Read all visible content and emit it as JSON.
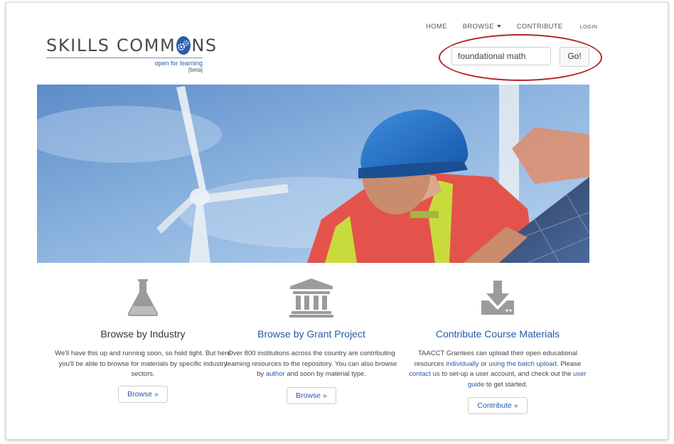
{
  "brand": {
    "name_part1": "SKILLS COMM",
    "name_part2": "NS",
    "tagline": "open for learning",
    "beta": "[beta]"
  },
  "nav": {
    "home": "HOME",
    "browse": "BROWSE",
    "contribute": "CONTRIBUTE",
    "login": "LOGIN"
  },
  "search": {
    "value": "foundational math",
    "button": "Go!"
  },
  "colors": {
    "accent": "#2a58a6",
    "highlight_oval": "#b3262c"
  },
  "columns": [
    {
      "icon": "flask-icon",
      "title": "Browse by Industry",
      "text": "We'll have this up and running soon, so hold tight. But here you'll be able to browse for materials by specific industry sectors.",
      "button": "Browse »"
    },
    {
      "icon": "institution-icon",
      "title": "Browse by Grant Project",
      "text_before": "Over 800 institutions across the country are contributing learning resources to the repository. You can also browse by ",
      "link_author": "author",
      "text_after": " and soon by material type.",
      "button": "Browse »"
    },
    {
      "icon": "download-icon",
      "title": "Contribute Course Materials",
      "t1": "TAACCT Grantees can upload their open educational resources ",
      "link_individually": "individually",
      "t2": " or ",
      "link_batch": "using the batch upload",
      "t3": ". Please ",
      "link_contact": "contact us",
      "t4": " to set-up a user account, and check out the ",
      "link_guide": "user guide",
      "t5": " to get started.",
      "button": "Contribute »"
    }
  ]
}
